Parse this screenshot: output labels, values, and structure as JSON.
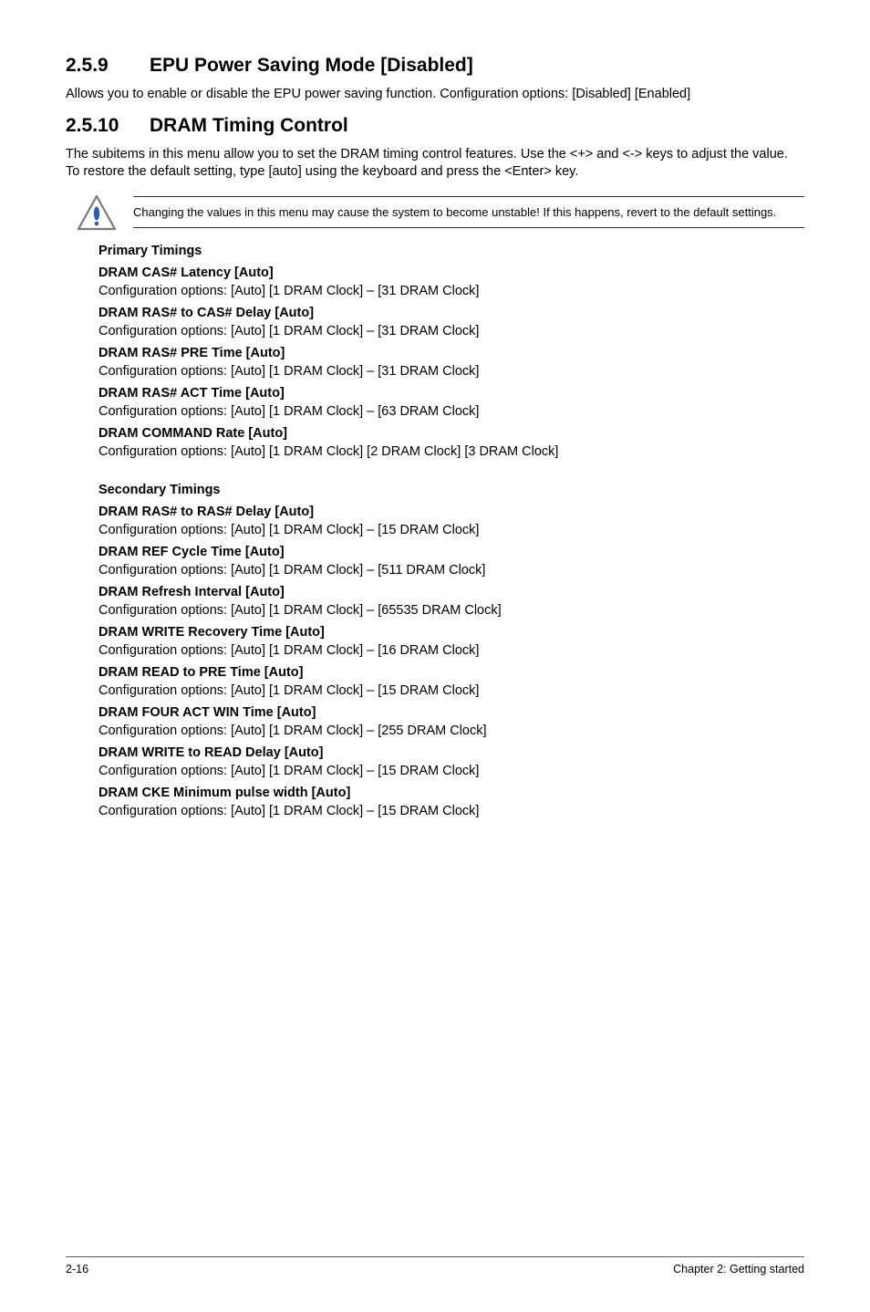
{
  "sec1": {
    "num": "2.5.9",
    "title": "EPU Power Saving Mode [Disabled]",
    "body": "Allows you to enable or disable the EPU power saving function. Configuration options: [Disabled] [Enabled]"
  },
  "sec2": {
    "num": "2.5.10",
    "title": "DRAM Timing Control",
    "body": "The subitems in this menu allow you to set the DRAM timing control features. Use the <+> and <-> keys to adjust the value. To restore the default setting, type [auto] using the keyboard and press the <Enter> key."
  },
  "caution": "Changing the values in this menu may cause the system to become unstable! If this happens, revert to the default settings.",
  "primary": {
    "header": "Primary Timings",
    "items": [
      {
        "label": "DRAM CAS# Latency [Auto]",
        "cfg": "Configuration options: [Auto] [1 DRAM Clock] – [31 DRAM Clock]"
      },
      {
        "label": "DRAM RAS# to CAS# Delay [Auto]",
        "cfg": "Configuration options: [Auto] [1 DRAM Clock] – [31 DRAM Clock]"
      },
      {
        "label": "DRAM RAS# PRE Time [Auto]",
        "cfg": "Configuration options: [Auto] [1 DRAM Clock] – [31 DRAM Clock]"
      },
      {
        "label": "DRAM RAS# ACT Time [Auto]",
        "cfg": "Configuration options: [Auto] [1 DRAM Clock] – [63 DRAM Clock]"
      },
      {
        "label": "DRAM COMMAND Rate [Auto]",
        "cfg": "Configuration options: [Auto] [1 DRAM Clock] [2 DRAM Clock] [3 DRAM Clock]"
      }
    ]
  },
  "secondary": {
    "header": "Secondary Timings",
    "items": [
      {
        "label": "DRAM RAS# to RAS# Delay [Auto]",
        "cfg": "Configuration options: [Auto] [1 DRAM Clock] – [15 DRAM Clock]"
      },
      {
        "label": "DRAM REF Cycle Time [Auto]",
        "cfg": "Configuration options: [Auto] [1 DRAM Clock] – [511 DRAM Clock]"
      },
      {
        "label": "DRAM Refresh Interval [Auto]",
        "cfg": "Configuration options: [Auto] [1 DRAM Clock] – [65535 DRAM Clock]"
      },
      {
        "label": "DRAM WRITE Recovery Time [Auto]",
        "cfg": "Configuration options: [Auto] [1 DRAM Clock] – [16 DRAM Clock]"
      },
      {
        "label": "DRAM READ to PRE Time [Auto]",
        "cfg": "Configuration options: [Auto] [1 DRAM Clock] – [15 DRAM Clock]"
      },
      {
        "label": "DRAM FOUR ACT WIN Time [Auto]",
        "cfg": "Configuration options: [Auto] [1 DRAM Clock] – [255 DRAM Clock]"
      },
      {
        "label": "DRAM WRITE to READ Delay [Auto]",
        "cfg": "Configuration options: [Auto] [1 DRAM Clock] – [15 DRAM Clock]"
      },
      {
        "label": "DRAM CKE Minimum pulse width [Auto]",
        "cfg": "Configuration options: [Auto] [1 DRAM Clock] – [15 DRAM Clock]"
      }
    ]
  },
  "footer": {
    "left": "2-16",
    "right": "Chapter 2: Getting started"
  }
}
